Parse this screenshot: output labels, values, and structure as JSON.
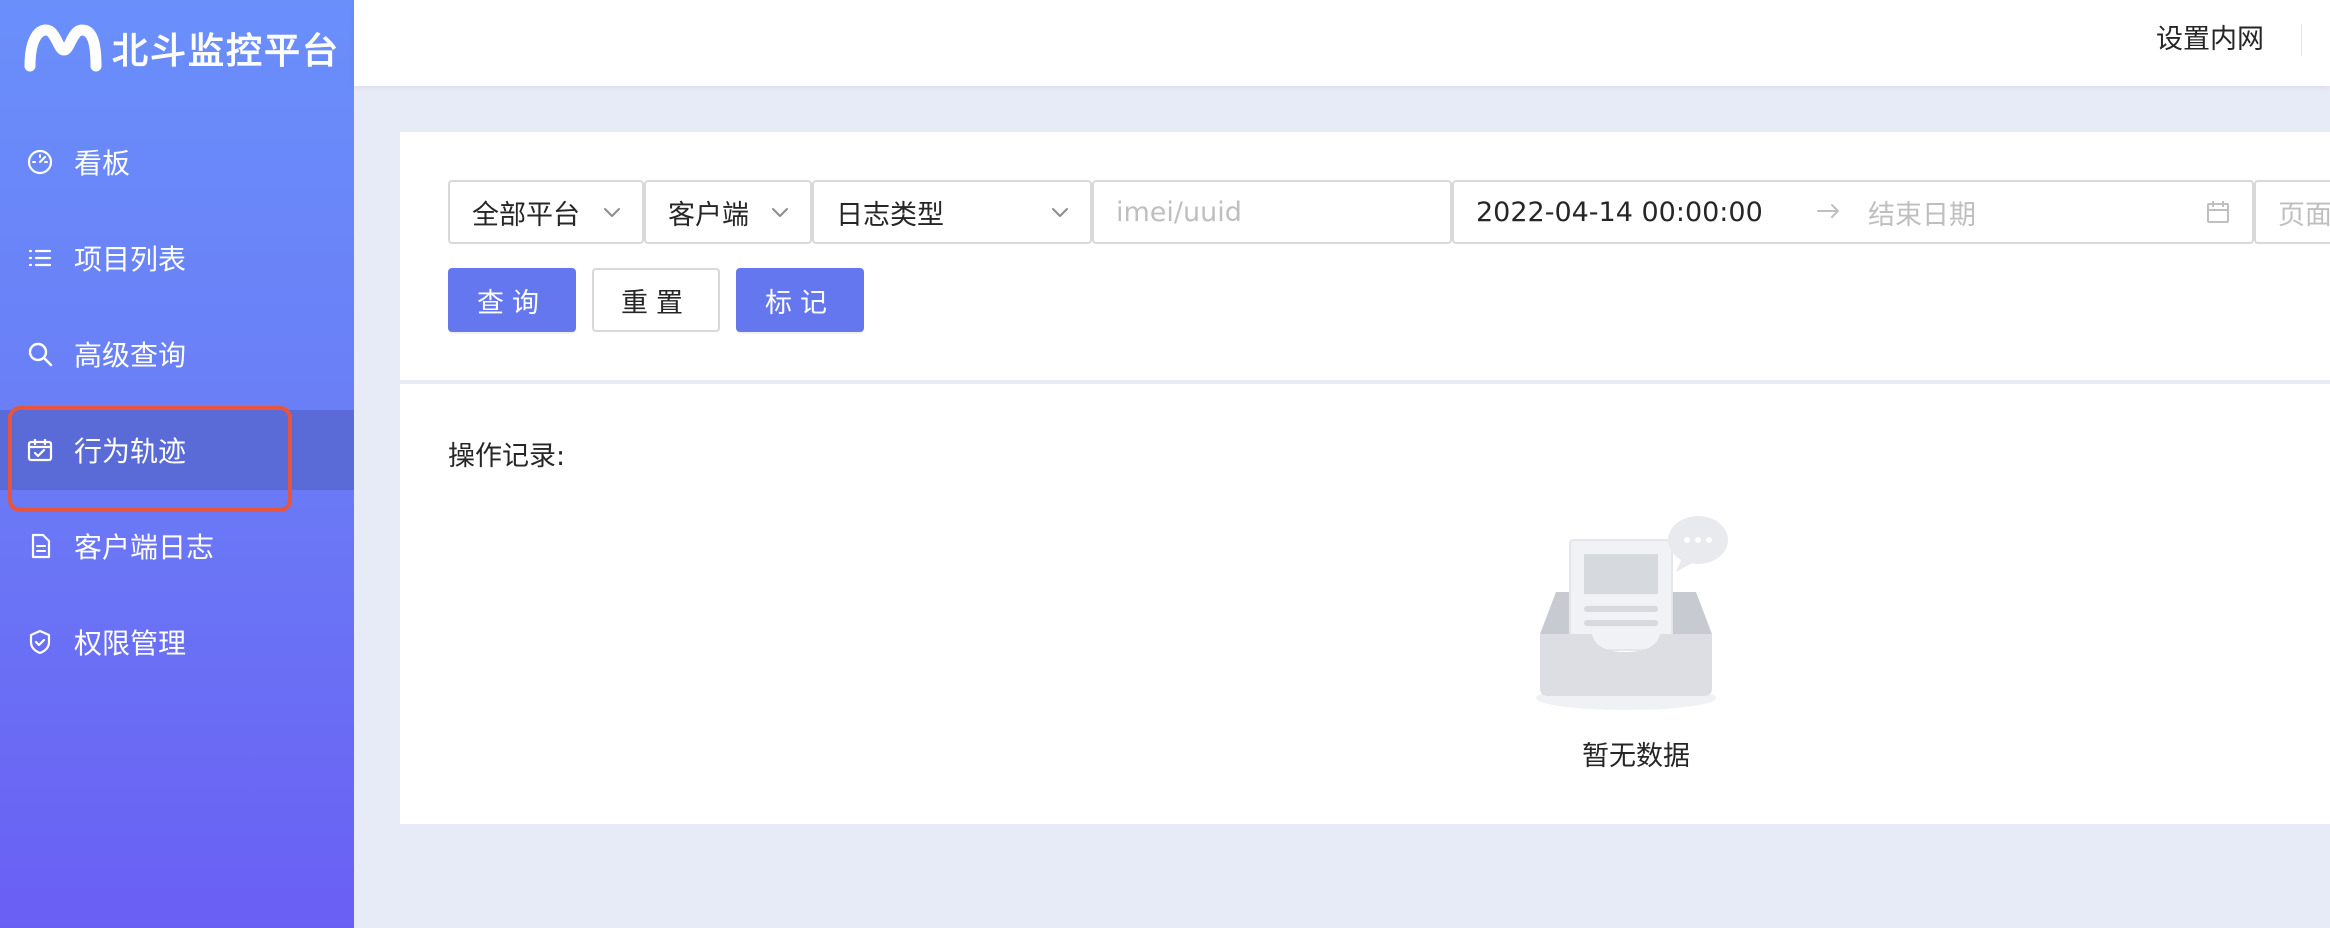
{
  "app": {
    "title": "北斗监控平台"
  },
  "sidebar": {
    "items": [
      {
        "label": "看板",
        "icon": "dashboard-icon"
      },
      {
        "label": "项目列表",
        "icon": "list-icon"
      },
      {
        "label": "高级查询",
        "icon": "search-icon"
      },
      {
        "label": "行为轨迹",
        "icon": "calendar-check-icon",
        "active": true
      },
      {
        "label": "客户端日志",
        "icon": "file-icon"
      },
      {
        "label": "权限管理",
        "icon": "shield-icon"
      }
    ]
  },
  "header": {
    "link_label": "设置内网"
  },
  "filters": {
    "platform": "全部平台",
    "client": "客户端",
    "log_type": "日志类型",
    "imei_placeholder": "imei/uuid",
    "date_start": "2022-04-14 00:00:00",
    "date_end_placeholder": "结束日期",
    "page_placeholder": "页面"
  },
  "actions": {
    "query": "查询",
    "reset": "重置",
    "mark": "标记"
  },
  "records": {
    "title": "操作记录:",
    "empty_text": "暂无数据"
  },
  "colors": {
    "primary": "#6577ee",
    "sidebar_active": "#5a6ad6",
    "highlight": "#e8553d"
  }
}
